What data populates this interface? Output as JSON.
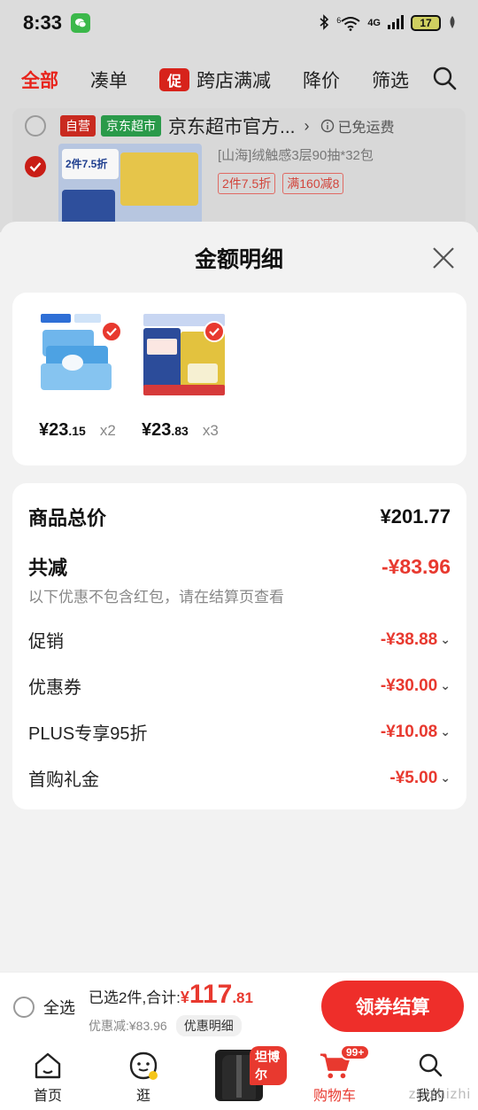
{
  "status_bar": {
    "time": "8:33",
    "network": "4G",
    "wifi_badge": "6",
    "battery": "17"
  },
  "filter_tabs": [
    "全部",
    "凑单",
    "跨店满减",
    "降价",
    "筛选"
  ],
  "promo_icon_text": "促",
  "shop": {
    "tag_self": "自营",
    "tag_market": "京东超市",
    "name": "京东超市官方...",
    "shipping": "已免运费",
    "item_title": "[山海]绒触感3层90抽*32包",
    "item_tags": [
      "2件7.5折",
      "满160减8"
    ],
    "thumb_badge": "2件7.5折"
  },
  "sheet": {
    "title": "金额明细",
    "goods": [
      {
        "price_int": "¥23",
        "price_dec": ".15",
        "qty": "x2"
      },
      {
        "price_int": "¥23",
        "price_dec": ".83",
        "qty": "x3"
      }
    ],
    "total_label": "商品总价",
    "total_value": "¥201.77",
    "discount_label": "共减",
    "discount_value": "-¥83.96",
    "discount_note": "以下优惠不包含红包，请在结算页查看",
    "items": [
      {
        "label": "促销",
        "value": "-¥38.88"
      },
      {
        "label": "优惠券",
        "value": "-¥30.00"
      },
      {
        "label": "PLUS专享95折",
        "value": "-¥10.08"
      },
      {
        "label": "首购礼金",
        "value": "-¥5.00"
      }
    ]
  },
  "checkout": {
    "select_all": "全选",
    "summary_text": "已选2件,合计:",
    "currency": "¥",
    "total_int": "117",
    "total_dec": ".81",
    "saved": "优惠减:¥83.96",
    "detail_chip": "优惠明细",
    "pay_button": "领券结算"
  },
  "nav": {
    "home": "首页",
    "explore": "逛",
    "promo_tag": "坦博尔",
    "cart": "购物车",
    "cart_badge": "99+",
    "mine": "我的"
  },
  "watermark": "zhizhizhi",
  "colors": {
    "accent": "#e8392f",
    "button": "#ee2e2a"
  }
}
